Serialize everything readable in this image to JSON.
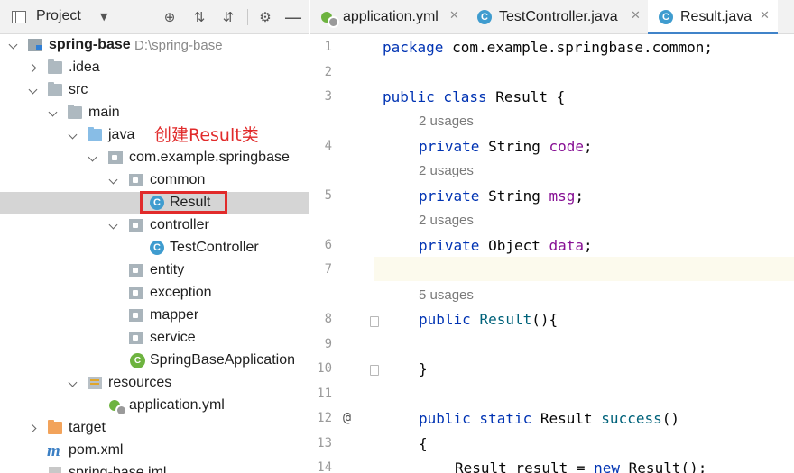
{
  "project_panel": {
    "title": "Project",
    "tree": [
      {
        "label": "spring-base",
        "path": "D:\\spring-base",
        "icon": "module-folder-icon"
      },
      {
        "label": ".idea",
        "icon": "folder-icon"
      },
      {
        "label": "src",
        "icon": "folder-icon"
      },
      {
        "label": "main",
        "icon": "folder-icon"
      },
      {
        "label": "java",
        "icon": "source-folder-icon"
      },
      {
        "label": "com.example.springbase",
        "icon": "package-icon"
      },
      {
        "label": "common",
        "icon": "package-icon"
      },
      {
        "label": "Result",
        "icon": "class-icon"
      },
      {
        "label": "controller",
        "icon": "package-icon"
      },
      {
        "label": "TestController",
        "icon": "class-icon"
      },
      {
        "label": "entity",
        "icon": "package-icon"
      },
      {
        "label": "exception",
        "icon": "package-icon"
      },
      {
        "label": "mapper",
        "icon": "package-icon"
      },
      {
        "label": "service",
        "icon": "package-icon"
      },
      {
        "label": "SpringBaseApplication",
        "icon": "spring-boot-class-icon"
      },
      {
        "label": "resources",
        "icon": "resources-folder-icon"
      },
      {
        "label": "application.yml",
        "icon": "spring-config-file-icon"
      },
      {
        "label": "target",
        "icon": "excluded-folder-icon"
      },
      {
        "label": "pom.xml",
        "icon": "maven-icon"
      },
      {
        "label": "spring-base.iml",
        "icon": "module-file-icon"
      }
    ],
    "annotation": "创建Result类"
  },
  "editor": {
    "tabs": [
      {
        "label": "application.yml",
        "icon": "spring-config-file-icon"
      },
      {
        "label": "TestController.java",
        "icon": "class-icon"
      },
      {
        "label": "Result.java",
        "icon": "class-icon"
      }
    ],
    "line_numbers": [
      "1",
      "2",
      "3",
      "4",
      "5",
      "6",
      "7",
      "8",
      "9",
      "10",
      "11",
      "12",
      "13",
      "14"
    ],
    "gutter_annotation": "@",
    "usages": {
      "code": "2 usages",
      "msg": "2 usages",
      "data": "2 usages",
      "constructor": "5 usages"
    },
    "code": {
      "l1_kw": "package",
      "l1_rest": " com.example.springbase.common;",
      "l3_kw": "public class",
      "l3_rest": " Result {",
      "l4_kw": "private",
      "l4_type": " String ",
      "l4_field": "code",
      "l4_end": ";",
      "l5_kw": "private",
      "l5_type": " String ",
      "l5_field": "msg",
      "l5_end": ";",
      "l6_kw": "private",
      "l6_type": " Object ",
      "l6_field": "data",
      "l6_end": ";",
      "l8_kw": "public",
      "l8_sp": " ",
      "l8_method": "Result",
      "l8_end": "(){",
      "l10": "}",
      "l12_kw": "public static",
      "l12_type": " Result ",
      "l12_method": "success",
      "l12_end": "()",
      "l13": "{",
      "l14_start": "Result result = ",
      "l14_kw": "new",
      "l14_end": " Result();"
    }
  }
}
